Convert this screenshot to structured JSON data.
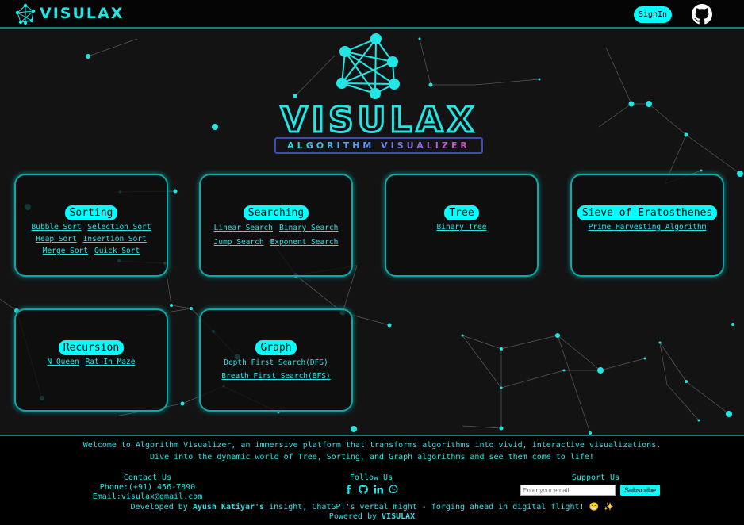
{
  "nav": {
    "brand": "VISULAX",
    "signin_label": "SignIn",
    "github_icon": "github-icon",
    "logo_icon": "network-logo-icon"
  },
  "hero": {
    "title": "VISULAX",
    "subtitle": "ALGORITHM VISUALIZER"
  },
  "cards": {
    "sorting": {
      "title": "Sorting",
      "links": [
        "Bubble Sort",
        "Selection Sort",
        "Heap Sort",
        "Insertion Sort",
        "Merge Sort",
        "Quick Sort"
      ]
    },
    "searching": {
      "title": "Searching",
      "links": [
        "Linear Search",
        "Binary Search",
        "Jump Search",
        "Exponent Search"
      ]
    },
    "tree": {
      "title": "Tree",
      "links": [
        "Binary Tree"
      ]
    },
    "sieve": {
      "title": "Sieve of Eratosthenes",
      "links": [
        "Prime Harvesting Algorithm"
      ]
    },
    "recursion": {
      "title": "Recursion",
      "links": [
        "N Queen",
        "Rat In Maze"
      ]
    },
    "graph": {
      "title": "Graph",
      "links": [
        "Depth First Search(DFS)",
        "Breath First Search(BFS)"
      ]
    }
  },
  "footer": {
    "welcome_1": "Welcome to Algorithm Visualizer, an immersive platform that transforms algorithms into vivid, interactive visualizations.",
    "welcome_2": "Dive into the dynamic world of Tree, Sorting, and Graph algorithms and see them come to life!",
    "contact_title": "Contact Us",
    "phone": "Phone:(+91) 456-7890",
    "email": "Email:visulax@gmail.com",
    "follow_title": "Follow Us",
    "social_icons": [
      "facebook-icon",
      "github-icon",
      "linkedin-icon",
      "whatsapp-icon"
    ],
    "support_title": "Support Us",
    "email_placeholder": "Enter your email",
    "subscribe_label": "Subscribe",
    "dev_prefix": "Developed by ",
    "dev_name": "Ayush Katiyar's",
    "dev_suffix": " insight, ChatGPT's verbal might - forging ahead in digital flight! 😁 ✨",
    "powered_prefix": "Powered by ",
    "powered_name": "VISULAX"
  },
  "colors": {
    "accent": "#00ffff",
    "background": "#131313",
    "border": "#0fa7a7"
  }
}
